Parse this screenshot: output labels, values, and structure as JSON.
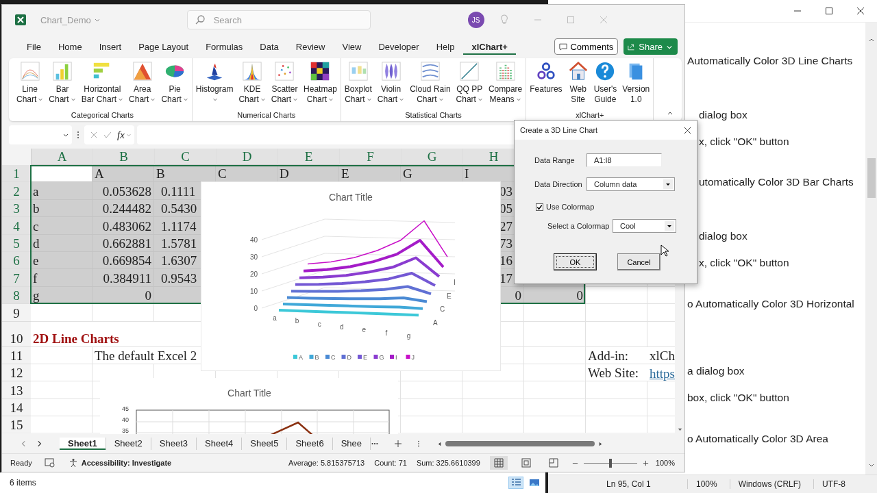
{
  "excel": {
    "file_name": "Chart_Demo",
    "search_placeholder": "Search",
    "avatar": "JS",
    "menu": [
      {
        "label": "File",
        "selected": false
      },
      {
        "label": "Home",
        "selected": false
      },
      {
        "label": "Insert",
        "selected": false
      },
      {
        "label": "Page Layout",
        "selected": false
      },
      {
        "label": "Formulas",
        "selected": false
      },
      {
        "label": "Data",
        "selected": false
      },
      {
        "label": "Review",
        "selected": false
      },
      {
        "label": "View",
        "selected": false
      },
      {
        "label": "Developer",
        "selected": false
      },
      {
        "label": "Help",
        "selected": false
      },
      {
        "label": "xlChart+",
        "selected": true
      }
    ],
    "comments": "Comments",
    "share": "Share",
    "ribbon_groups": [
      {
        "label": "Categorical Charts",
        "buttons": [
          {
            "kind": "line",
            "line1": "Line",
            "line2": "Chart",
            "dropdown": true
          },
          {
            "kind": "bar",
            "line1": "Bar",
            "line2": "Chart",
            "dropdown": true
          },
          {
            "kind": "hbar",
            "line1": "Horizontal",
            "line2": "Bar Chart",
            "dropdown": true
          },
          {
            "kind": "area",
            "line1": "Area",
            "line2": "Chart",
            "dropdown": true
          },
          {
            "kind": "pie",
            "line1": "Pie",
            "line2": "Chart",
            "dropdown": true
          }
        ]
      },
      {
        "label": "Numerical Charts",
        "buttons": [
          {
            "kind": "histogram",
            "line1": "Histogram",
            "dropdown": true
          },
          {
            "kind": "kde",
            "line1": "KDE",
            "line2": "Chart",
            "dropdown": true
          },
          {
            "kind": "scatter",
            "line1": "Scatter",
            "line2": "Chart",
            "dropdown": true
          },
          {
            "kind": "heatmap",
            "line1": "Heatmap",
            "line2": "Chart",
            "dropdown": true
          }
        ]
      },
      {
        "label": "Statistical Charts",
        "buttons": [
          {
            "kind": "boxplot",
            "line1": "Boxplot",
            "line2": "Chart",
            "dropdown": true
          },
          {
            "kind": "violin",
            "line1": "Violin",
            "line2": "Chart",
            "dropdown": true
          },
          {
            "kind": "cloudrain",
            "line1": "Cloud Rain",
            "line2": "Chart",
            "dropdown": true
          },
          {
            "kind": "qq",
            "line1": "QQ PP",
            "line2": "Chart",
            "dropdown": true
          },
          {
            "kind": "compare",
            "line1": "Compare",
            "line2": "Means",
            "dropdown": true
          }
        ]
      },
      {
        "label": "xlChart+",
        "buttons": [
          {
            "kind": "gears",
            "line1": "Features",
            "dropdown": false
          },
          {
            "kind": "house",
            "line1": "Web",
            "line2": "Site",
            "dropdown": false
          },
          {
            "kind": "help",
            "line1": "User's",
            "line2": "Guide",
            "dropdown": false
          },
          {
            "kind": "docs",
            "line1": "Version",
            "line2": "1.0",
            "dropdown": false
          }
        ]
      }
    ],
    "fx_label": "fx",
    "columns": [
      {
        "label": "A",
        "selected": true
      },
      {
        "label": "B",
        "selected": true
      },
      {
        "label": "C",
        "selected": true
      },
      {
        "label": "D",
        "selected": true
      },
      {
        "label": "E",
        "selected": true
      },
      {
        "label": "F",
        "selected": true
      },
      {
        "label": "G",
        "selected": true
      },
      {
        "label": "H",
        "selected": true
      }
    ],
    "rows": [
      {
        "number": "1",
        "selected": true,
        "active": true,
        "selected_cells": [
          null,
          "A",
          "B",
          "C",
          "D",
          "E",
          "G",
          "I",
          null
        ],
        "cells": [
          null,
          null
        ]
      },
      {
        "number": "2",
        "selected": true,
        "active": false,
        "selected_cells": [
          "a",
          {
            "text": "0.053628",
            "kind": "num"
          },
          {
            "text": "0.1111",
            "kind": "cut-left"
          },
          null,
          null,
          null,
          null,
          {
            "text": "03",
            "kind": "cut-right"
          },
          null
        ],
        "cells": [
          null,
          null
        ]
      },
      {
        "number": "3",
        "selected": true,
        "active": false,
        "selected_cells": [
          "b",
          {
            "text": "0.244482",
            "kind": "num"
          },
          {
            "text": "0.5430",
            "kind": "cut-left"
          },
          null,
          null,
          null,
          null,
          {
            "text": "05",
            "kind": "cut-right"
          },
          null
        ],
        "cells": [
          null,
          null
        ]
      },
      {
        "number": "4",
        "selected": true,
        "active": false,
        "selected_cells": [
          "c",
          {
            "text": "0.483062",
            "kind": "num"
          },
          {
            "text": "1.1174",
            "kind": "cut-left"
          },
          null,
          null,
          null,
          null,
          {
            "text": "27",
            "kind": "cut-right"
          },
          null
        ],
        "cells": [
          null,
          null
        ]
      },
      {
        "number": "5",
        "selected": true,
        "active": false,
        "selected_cells": [
          "d",
          {
            "text": "0.662881",
            "kind": "num"
          },
          {
            "text": "1.5781",
            "kind": "cut-left"
          },
          null,
          null,
          null,
          null,
          {
            "text": "73",
            "kind": "cut-right"
          },
          null
        ],
        "cells": [
          null,
          null
        ]
      },
      {
        "number": "6",
        "selected": true,
        "active": false,
        "selected_cells": [
          "e",
          {
            "text": "0.669854",
            "kind": "num"
          },
          {
            "text": "1.6307",
            "kind": "cut-left"
          },
          null,
          null,
          null,
          null,
          {
            "text": "16",
            "kind": "cut-right"
          },
          null
        ],
        "cells": [
          null,
          null
        ]
      },
      {
        "number": "7",
        "selected": true,
        "active": false,
        "selected_cells": [
          "f",
          {
            "text": "0.384911",
            "kind": "num"
          },
          {
            "text": "0.9543",
            "kind": "cut-left"
          },
          null,
          null,
          null,
          null,
          {
            "text": "17",
            "kind": "cut-right"
          },
          null
        ],
        "cells": [
          null,
          null
        ]
      },
      {
        "number": "8",
        "selected": true,
        "active": false,
        "selected_cells": [
          "g",
          {
            "text": "0",
            "kind": "num"
          },
          null,
          null,
          null,
          null,
          null,
          {
            "text": "0",
            "kind": "num"
          },
          {
            "text": "0",
            "kind": "num"
          }
        ],
        "cells": [
          null,
          null
        ]
      },
      {
        "number": "9",
        "selected": false,
        "cells": [
          null,
          null,
          null,
          null,
          null,
          null,
          null,
          null,
          null,
          null,
          null
        ]
      },
      {
        "number": "10",
        "selected": false,
        "cells": [
          {
            "text": "2D Line Charts",
            "kind": "heading"
          },
          null,
          null,
          null,
          null,
          null,
          null,
          null,
          null,
          null,
          null
        ]
      },
      {
        "number": "11",
        "selected": false,
        "cells": [
          null,
          "The default Excel 2",
          null,
          null,
          null,
          null,
          null,
          null,
          null,
          "Add-in:",
          "xlCh"
        ]
      },
      {
        "number": "12",
        "selected": false,
        "cells": [
          null,
          null,
          null,
          null,
          null,
          null,
          null,
          null,
          null,
          "Web Site:",
          {
            "text": "https",
            "kind": "link"
          }
        ]
      },
      {
        "number": "13",
        "selected": false,
        "cells": [
          null,
          null,
          null,
          null,
          null,
          null,
          null,
          null,
          null,
          null,
          null
        ]
      },
      {
        "number": "14",
        "selected": false,
        "cells": [
          null,
          null,
          null,
          null,
          null,
          null,
          null,
          null,
          null,
          null,
          null
        ]
      },
      {
        "number": "15",
        "selected": false,
        "cells": [
          null,
          null,
          null,
          null,
          null,
          null,
          null,
          null,
          null,
          null,
          null
        ]
      }
    ],
    "chart_3d": {
      "title": "Chart Title",
      "y_ticks": [
        "40",
        "30",
        "20",
        "10",
        "0"
      ],
      "categories": [
        "a",
        "b",
        "c",
        "d",
        "e",
        "f",
        "g"
      ],
      "depth_labels": [
        "I",
        "E",
        "C",
        "A"
      ],
      "legend": [
        {
          "label": "A",
          "color": "#3cc8d8"
        },
        {
          "label": "B",
          "color": "#40a8d8"
        },
        {
          "label": "C",
          "color": "#4a8ad4"
        },
        {
          "label": "D",
          "color": "#6070d4"
        },
        {
          "label": "E",
          "color": "#7458d4"
        },
        {
          "label": "G",
          "color": "#8a3cd0"
        },
        {
          "label": "I",
          "color": "#a41cc8"
        },
        {
          "label": "J",
          "color": "#c810c8"
        }
      ]
    },
    "chart_2d": {
      "title": "Chart Title",
      "y_ticks": [
        "45",
        "40",
        "35"
      ]
    },
    "sheets": [
      {
        "label": "Sheet1",
        "selected": true
      },
      {
        "label": "Sheet2",
        "selected": false
      },
      {
        "label": "Sheet3",
        "selected": false
      },
      {
        "label": "Sheet4",
        "selected": false
      },
      {
        "label": "Sheet5",
        "selected": false
      },
      {
        "label": "Sheet6",
        "selected": false
      },
      {
        "label": "Shee",
        "selected": false
      }
    ],
    "status": {
      "ready": "Ready",
      "accessibility": "Accessibility: Investigate",
      "average": "Average: 5.815375713",
      "count": "Count: 71",
      "sum": "Sum: 325.6610399",
      "zoom": "100%"
    },
    "zoom_slider": {
      "level": 0.5
    }
  },
  "dialog": {
    "title": "Create a 3D Line Chart",
    "range_label": "Data Range",
    "range_value": "A1:I8",
    "direction_label": "Data Direction",
    "direction_value": "Column data",
    "colormap_check": {
      "label": "Use Colormap",
      "checked": true
    },
    "colormap_label": "Select a Colormap",
    "colormap_value": "Cool",
    "ok": "OK",
    "cancel": "Cancel"
  },
  "notepad": {
    "lines": [
      {
        "text": "Automatically Color 3D Line Charts",
        "kind": "heading"
      },
      {
        "text": "dialog box",
        "kind": "step1"
      },
      {
        "text": "x, click \"OK\" button",
        "kind": "step2"
      },
      {
        "text": "utomatically Color 3D Bar Charts",
        "kind": "heading"
      },
      {
        "text": "dialog box",
        "kind": "step1"
      },
      {
        "text": "x, click \"OK\" button",
        "kind": "step2"
      },
      {
        "text": "o Automatically Color 3D Horizontal",
        "kind": "heading-wrapped"
      },
      {
        "text": "a dialog box",
        "kind": "step1"
      },
      {
        "text": "box, click \"OK\" button",
        "kind": "step2"
      },
      {
        "text": "o Automatically Color 3D Area",
        "kind": "heading"
      }
    ],
    "status": [
      "Ln 95, Col 1",
      "100%",
      "Windows (CRLF)",
      "UTF-8"
    ]
  },
  "explorer": {
    "status": "6 items"
  }
}
